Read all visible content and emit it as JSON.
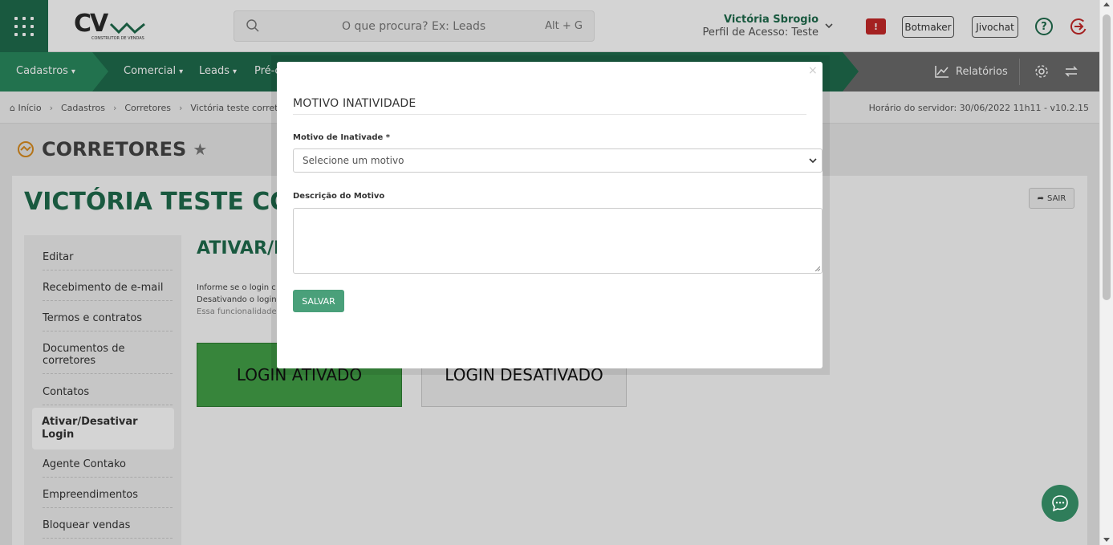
{
  "header": {
    "logo_text": "CV",
    "logo_subtext": "CONSTRUTOR DE VENDAS",
    "search_placeholder": "O que procura? Ex: Leads",
    "search_shortcut": "Alt + G",
    "user_name": "Victória Sbrogio",
    "user_profile": "Perfil de Acesso: Teste",
    "alert_label": "!",
    "botmaker_label": "Botmaker",
    "jivochat_label": "Jivochat",
    "help_label": "?"
  },
  "nav": {
    "items": [
      {
        "label": "Cadastros"
      },
      {
        "label": "Comercial"
      },
      {
        "label": "Leads"
      },
      {
        "label": "Pré-c"
      }
    ],
    "reports_label": "Relatórios"
  },
  "breadcrumb": {
    "items": [
      "Início",
      "Cadastros",
      "Corretores",
      "Victória teste corretor"
    ],
    "server_time": "Horário do servidor: 30/06/2022 11h11 - v10.2.15"
  },
  "page": {
    "title": "CORRETORES",
    "entity_title": "VICTÓRIA TESTE CORR",
    "exit_label": "SAIR",
    "section_title": "ATIVAR/D",
    "info_lines": [
      "Informe se o login c",
      "Desativando o login",
      "Essa funcionalidade"
    ],
    "login_on_label": "LOGIN ATIVADO",
    "login_off_label": "LOGIN DESATIVADO"
  },
  "sidemenu": {
    "items": [
      {
        "label": "Editar"
      },
      {
        "label": "Recebimento de e-mail"
      },
      {
        "label": "Termos e contratos"
      },
      {
        "label": "Documentos de corretores"
      },
      {
        "label": "Contatos"
      },
      {
        "label": "Ativar/Desativar Login"
      },
      {
        "label": "Agente Contako"
      },
      {
        "label": "Empreendimentos"
      },
      {
        "label": "Bloquear vendas"
      }
    ]
  },
  "modal": {
    "close_label": "×",
    "title": "MOTIVO INATIVIDADE",
    "reason_label": "Motivo de Inativade *",
    "reason_placeholder": "Selecione um motivo",
    "description_label": "Descrição do Motivo",
    "save_label": "SALVAR"
  },
  "colors": {
    "brand_green": "#1f6b4c",
    "nav_green_light": "#2a8a5e",
    "login_active": "#43a047",
    "save_button": "#4aa07a",
    "alert_red": "#c62828"
  }
}
